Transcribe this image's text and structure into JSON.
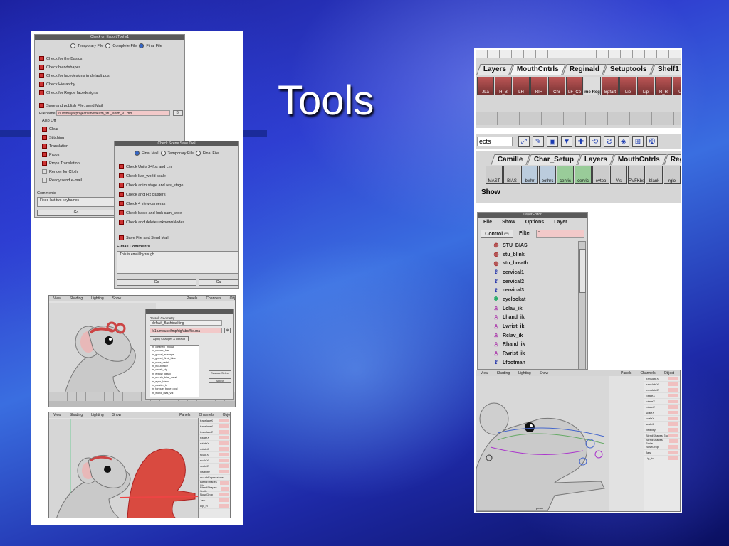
{
  "slide": {
    "title": "Tools"
  },
  "export_dialog": {
    "title": "Check on Export Tool v1",
    "radios": [
      "Temporary File",
      "Complete File",
      "Final File"
    ],
    "checks": [
      "Check for the Basics",
      "Check blendshapes",
      "Check for facedesigns in default pos",
      "Check Hierarchy",
      "Check for Rogue facedesigns"
    ],
    "save_label": "Save and publish File, send Mail",
    "filename_label": "Filename",
    "filename_value": "/s1o/maya/projects/movie/fm_stu_anim_v1.mb",
    "browse": "Br",
    "also_label": "Also Off",
    "sub_checks": [
      "Clear",
      "Stitching",
      "Translation",
      "Props",
      "Props Translation",
      "Render for Cloth",
      "Ready send e-mail"
    ],
    "comments_label": "Comments",
    "comments_value": "Fixed last two keyframes",
    "go": "Go"
  },
  "scene_dialog": {
    "title": "Check Scene Save Tool",
    "radios": [
      "Final Mail",
      "Temporary File",
      "Final File"
    ],
    "checks": [
      "Check Units 24fps and cm",
      "Check live_world scale",
      "Check anim stage and res_stage",
      "Check and Fix clusters",
      "Check 4 view cameras",
      "Check basic and lock cam_wide",
      "Check and delete unknownNodes"
    ],
    "save_label": "Save File and Send Mail",
    "email_label": "E-mail Comments",
    "email_value": "This is email by rough",
    "go": "Go",
    "cancel": "Ca"
  },
  "viewport_menu": [
    "View",
    "Shading",
    "Lighting",
    "Show"
  ],
  "viewport_right": [
    "Panels",
    "Channels",
    "Object"
  ],
  "bottom_right_menu": [
    "Panels",
    "Channels",
    "Object"
  ],
  "default_dialog": {
    "label": "Default Geometry",
    "select_value": "default_flashbacking",
    "path": "/s1o/mouse/tmp/rig/abc/file.ma",
    "apply": "Apply Changes & Default",
    "list": [
      "fn_cleaned_mouse",
      "fn_mouse_low",
      "fn_global_average",
      "fn_global_final_bias",
      "fn_nose_detail",
      "fn_mouthface",
      "fn_cheek_rig",
      "fn_ebrow_detail",
      "fn_mouth_bias_detail",
      "fn_eyes_blend",
      "fn_master_bl",
      "fn_tongue_bone_dpcl",
      "fn_world_bias_vol"
    ],
    "btn_1": "Restore Select",
    "btn_2": "Select"
  },
  "channels_top": [
    "translateX",
    "translateY",
    "translateZ",
    "rotateX",
    "rotateY",
    "rotateZ",
    "scaleX",
    "scaleY",
    "scaleZ",
    "visibility"
  ],
  "channels_bottom": [
    "mouthExpressions",
    "BlendShapes Stu",
    "BlendShapes Smile",
    "NoseDrop",
    "Jaw",
    "Lip_in"
  ],
  "shelf_top": {
    "tabs": [
      "Layers",
      "MouthCntrls",
      "Reginald",
      "Setuptools",
      "Shelf1"
    ],
    "icons": [
      "JLa",
      "H_B",
      "LH",
      "RIR",
      "Chr",
      "LF_Cb",
      "me Reg",
      "Bpfart",
      "Lip",
      "Lip",
      "R_R",
      "Up"
    ],
    "field_value": "ects",
    "tabs2": [
      "Camille",
      "Char_Setup",
      "Layers",
      "MouthCntrls",
      "Reg"
    ],
    "icons2": [
      "MAST",
      "BIAS",
      "bwhr",
      "bothrc",
      "cervic",
      "cervic",
      "eytoo",
      "Vis",
      "RVFKbs",
      "blank",
      "rglo"
    ],
    "show": "Show"
  },
  "layer_editor": {
    "title": "LayerEditor",
    "menu": [
      "File",
      "Show",
      "Options",
      "Layer"
    ],
    "control": "Control",
    "filter": "Filter",
    "filter_value": "*",
    "items": [
      {
        "name": "STU_BIAS",
        "icon": "cluster-icon"
      },
      {
        "name": "stu_blink",
        "icon": "cluster-icon"
      },
      {
        "name": "stu_breath",
        "icon": "cluster-icon"
      },
      {
        "name": "cervical1",
        "icon": "joint-icon"
      },
      {
        "name": "cervical2",
        "icon": "joint-icon"
      },
      {
        "name": "cervical3",
        "icon": "joint-icon"
      },
      {
        "name": "eyelookat",
        "icon": "locator-icon"
      },
      {
        "name": "Lclav_ik",
        "icon": "ik-icon"
      },
      {
        "name": "Lhand_ik",
        "icon": "ik-icon"
      },
      {
        "name": "Lwrist_ik",
        "icon": "ik-icon"
      },
      {
        "name": "Rclav_ik",
        "icon": "ik-icon"
      },
      {
        "name": "Rhand_ik",
        "icon": "ik-icon"
      },
      {
        "name": "Rwrist_ik",
        "icon": "ik-icon"
      },
      {
        "name": "Lfootman",
        "icon": "joint-icon"
      }
    ]
  },
  "rig_view": {
    "menu": [
      "View",
      "Shading",
      "Lighting",
      "Show"
    ],
    "right": [
      "Panels",
      "Channels",
      "Object"
    ],
    "footer": "persp"
  },
  "colors": {
    "accent": "#3a6ee0",
    "channel_value": "#f0c0c0",
    "field_pink": "#f2c9c9"
  }
}
